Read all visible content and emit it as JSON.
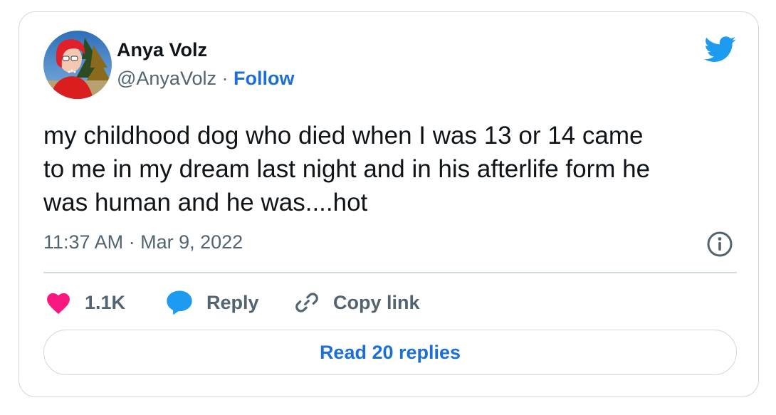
{
  "author": {
    "name": "Anya Volz",
    "handle": "@AnyaVolz",
    "separator": "·",
    "follow_label": "Follow",
    "avatar": "profile-photo"
  },
  "tweet": {
    "lines": [
      "my childhood dog who died when I was 13 or 14 came",
      "to me in my dream last night and in his afterlife form he",
      "was human and he was....hot"
    ],
    "time": "11:37 AM",
    "date": "Mar 9, 2022",
    "separator": "·"
  },
  "actions": {
    "like_count": "1.1K",
    "reply_label": "Reply",
    "copy_link_label": "Copy link"
  },
  "read_replies_label": "Read 20 replies",
  "icons": {
    "brand": "twitter-bird-icon",
    "info": "info-icon",
    "like": "heart-icon",
    "reply": "speech-bubble-icon",
    "copy": "link-icon"
  },
  "colors": {
    "link_blue": "#1d6fd6",
    "twitter_blue": "#1d9bf0",
    "like_pink": "#f91880",
    "muted_text": "#536471",
    "border": "#cfd9de",
    "text": "#0f1419"
  }
}
